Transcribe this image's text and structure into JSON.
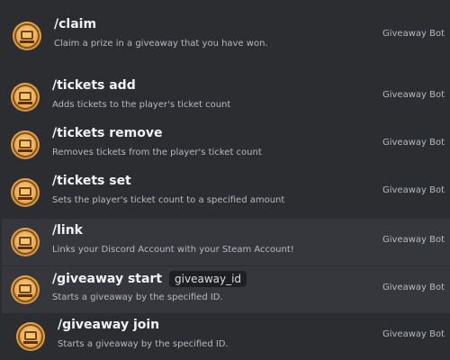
{
  "commands": [
    {
      "name": "/claim",
      "description": "Claim a prize in a giveaway that you have won.",
      "app": "Giveaway Bot",
      "param": ""
    },
    {
      "name": "/tickets add",
      "description": "Adds tickets to the player's ticket count",
      "app": "Giveaway Bot",
      "param": ""
    },
    {
      "name": "/tickets remove",
      "description": "Removes tickets from the player's ticket count",
      "app": "Giveaway Bot",
      "param": ""
    },
    {
      "name": "/tickets set",
      "description": "Sets the player's ticket count to a specified amount",
      "app": "Giveaway Bot",
      "param": ""
    },
    {
      "name": "/link",
      "description": "Links your Discord Account with your Steam Account!",
      "app": "Giveaway Bot",
      "param": ""
    },
    {
      "name": "/giveaway start",
      "description": "Starts a giveaway by the specified ID.",
      "app": "Giveaway Bot",
      "param": "giveaway_id"
    },
    {
      "name": "/giveaway join",
      "description": "Starts a giveaway by the specified ID.",
      "app": "Giveaway Bot",
      "param": ""
    }
  ],
  "icons": {
    "command_avatar": "giveaway-bot-avatar-icon"
  },
  "colors": {
    "background": "#2b2d31",
    "highlight": "#36373d",
    "param_bg": "#1e1f22"
  }
}
